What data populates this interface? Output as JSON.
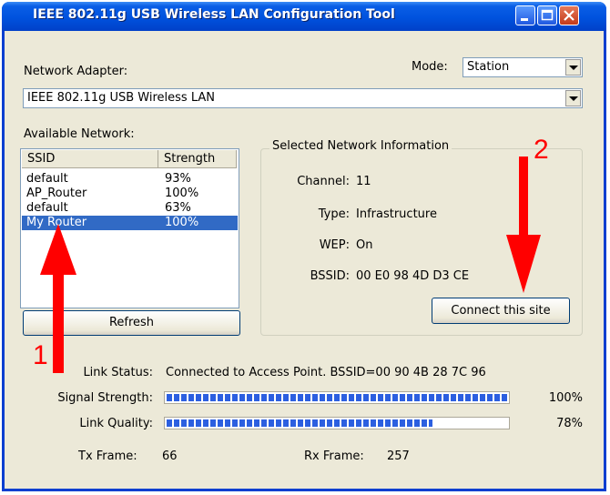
{
  "window": {
    "title": "IEEE 802.11g USB Wireless LAN Configuration Tool"
  },
  "adapter": {
    "label": "Network Adapter:",
    "value": "IEEE 802.11g USB Wireless LAN"
  },
  "mode": {
    "label": "Mode:",
    "value": "Station"
  },
  "available": {
    "label": "Available Network:",
    "columns": [
      "SSID",
      "Strength"
    ],
    "rows": [
      {
        "ssid": "default",
        "strength": "93%"
      },
      {
        "ssid": "AP_Router",
        "strength": "100%"
      },
      {
        "ssid": "default",
        "strength": "63%"
      },
      {
        "ssid": "My Router",
        "strength": "100%"
      }
    ],
    "selected_index": 3
  },
  "refresh_label": "Refresh",
  "selected_info": {
    "legend": "Selected Network Information",
    "channel_label": "Channel:",
    "channel": "11",
    "type_label": "Type:",
    "type": "Infrastructure",
    "wep_label": "WEP:",
    "wep": "On",
    "bssid_label": "BSSID:",
    "bssid": "00 E0 98 4D D3 CE",
    "connect_label": "Connect this site"
  },
  "status": {
    "link_status_label": "Link Status:",
    "link_status": "Connected to Access Point. BSSID=00 90 4B 28 7C 96",
    "signal_label": "Signal Strength:",
    "signal_text": "100%",
    "signal": 1.0,
    "quality_label": "Link Quality:",
    "quality_text": "78%",
    "quality": 0.78,
    "tx_label": "Tx Frame:",
    "tx": "66",
    "rx_label": "Rx Frame:",
    "rx": "257"
  },
  "annotations": {
    "arrow1": "1",
    "arrow2": "2",
    "color": "#ff0000"
  },
  "colors": {
    "title_bar": "#0052de",
    "selection": "#316ac5",
    "progress": "#2c5fe0"
  }
}
